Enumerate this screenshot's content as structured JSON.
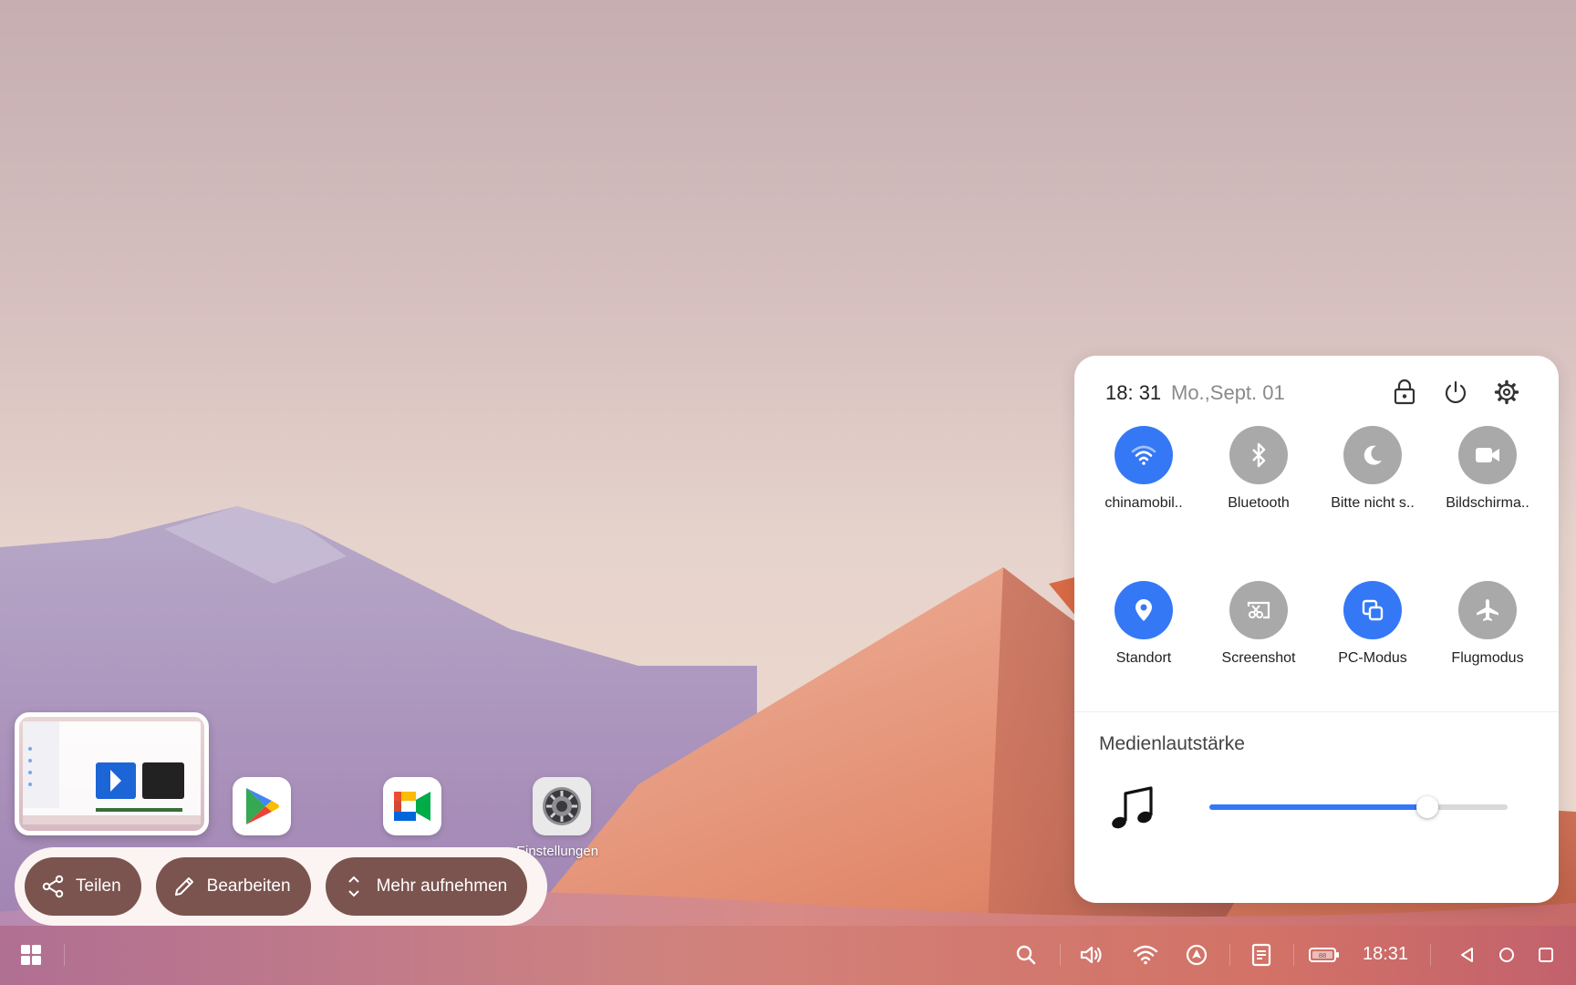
{
  "desktop": {
    "icons": [
      {
        "name": "Google Play Store",
        "label": ""
      },
      {
        "name": "Google Meet",
        "label": ""
      },
      {
        "name": "Einstellungen",
        "label": "Einstellungen"
      }
    ]
  },
  "screenshot_toolbar": {
    "share_label": "Teilen",
    "edit_label": "Bearbeiten",
    "more_label": "Mehr aufnehmen"
  },
  "quick_settings": {
    "time": "18: 31",
    "date": "Mo.,Sept. 01",
    "top_icons": [
      "lock-icon",
      "power-icon",
      "gear-icon"
    ],
    "tiles": [
      {
        "label": "chinamobil..",
        "icon": "wifi-icon",
        "active": true
      },
      {
        "label": "Bluetooth",
        "icon": "bluetooth-icon",
        "active": false
      },
      {
        "label": "Bitte nicht s..",
        "icon": "moon-icon",
        "active": false
      },
      {
        "label": "Bildschirma..",
        "icon": "video-camera-icon",
        "active": false
      },
      {
        "label": "Standort",
        "icon": "location-pin-icon",
        "active": true
      },
      {
        "label": "Screenshot",
        "icon": "screenshot-icon",
        "active": false
      },
      {
        "label": "PC-Modus",
        "icon": "pc-mode-icon",
        "active": true
      },
      {
        "label": "Flugmodus",
        "icon": "airplane-icon",
        "active": false
      }
    ],
    "volume": {
      "title": "Medienlautstärke",
      "icon": "music-note-icon",
      "level": 0.73
    }
  },
  "taskbar": {
    "clock": "18:31",
    "icons": [
      "app-launcher-icon",
      "search-icon",
      "volume-icon",
      "wifi-icon",
      "navigation-icon",
      "notes-icon",
      "battery-icon",
      "back-icon",
      "home-icon",
      "recents-icon"
    ],
    "battery_label": "88"
  },
  "colors": {
    "accent": "#3478f6",
    "tile_off": "#a9a9a9",
    "action_button": "#7b544f"
  }
}
